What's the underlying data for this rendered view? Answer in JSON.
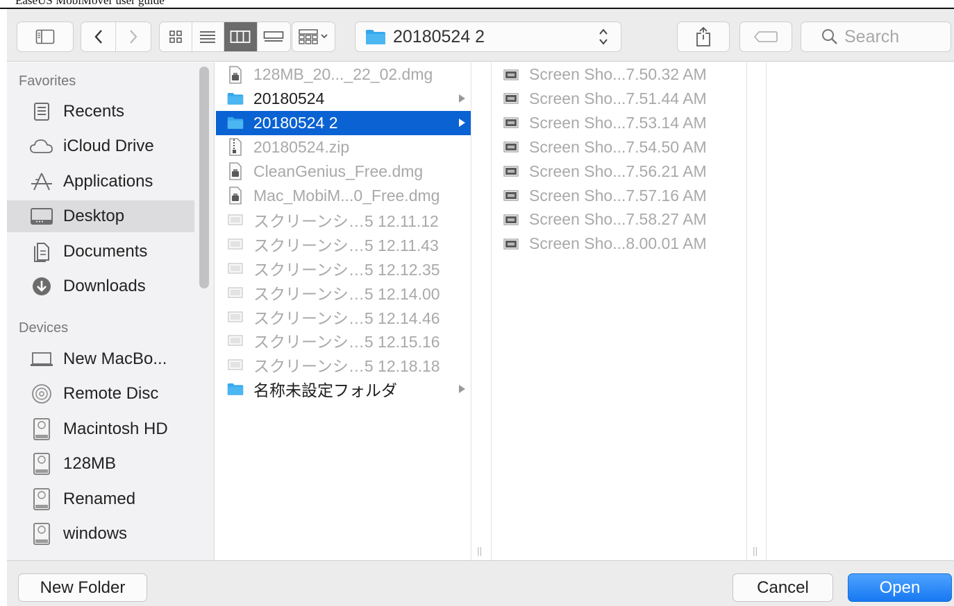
{
  "doc_header": {
    "text": "EaseUS MobiMover user guide"
  },
  "toolbar": {
    "path_label": "20180524 2",
    "search_placeholder": "Search"
  },
  "sidebar": {
    "favorites_heading": "Favorites",
    "favorites": [
      {
        "label": "Recents",
        "icon": "recents-icon"
      },
      {
        "label": "iCloud Drive",
        "icon": "icloud-icon"
      },
      {
        "label": "Applications",
        "icon": "applications-icon"
      },
      {
        "label": "Desktop",
        "icon": "desktop-icon",
        "selected": true
      },
      {
        "label": "Documents",
        "icon": "documents-icon"
      },
      {
        "label": "Downloads",
        "icon": "downloads-icon"
      }
    ],
    "devices_heading": "Devices",
    "devices": [
      {
        "label": "New   MacBo...",
        "icon": "laptop-icon"
      },
      {
        "label": "Remote Disc",
        "icon": "disc-icon"
      },
      {
        "label": "Macintosh HD",
        "icon": "drive-icon"
      },
      {
        "label": "128MB",
        "icon": "drive-icon"
      },
      {
        "label": "Renamed",
        "icon": "drive-icon"
      },
      {
        "label": "windows",
        "icon": "drive-icon"
      }
    ]
  },
  "column1": [
    {
      "label": "128MB_20..._22_02.dmg",
      "type": "dmg",
      "state": "dim"
    },
    {
      "label": "20180524",
      "type": "folder",
      "state": "dark",
      "arrow": true
    },
    {
      "label": "20180524 2",
      "type": "folder",
      "state": "selected",
      "arrow": true
    },
    {
      "label": "20180524.zip",
      "type": "zip",
      "state": "dim"
    },
    {
      "label": "CleanGenius_Free.dmg",
      "type": "dmg",
      "state": "dim"
    },
    {
      "label": "Mac_MobiM...0_Free.dmg",
      "type": "dmg",
      "state": "dim"
    },
    {
      "label": "スクリーンシ…5 12.11.12",
      "type": "image",
      "state": "dim"
    },
    {
      "label": "スクリーンシ…5 12.11.43",
      "type": "image",
      "state": "dim"
    },
    {
      "label": "スクリーンシ…5 12.12.35",
      "type": "image",
      "state": "dim"
    },
    {
      "label": "スクリーンシ…5 12.14.00",
      "type": "image",
      "state": "dim"
    },
    {
      "label": "スクリーンシ…5 12.14.46",
      "type": "image",
      "state": "dim"
    },
    {
      "label": "スクリーンシ…5 12.15.16",
      "type": "image",
      "state": "dim"
    },
    {
      "label": "スクリーンシ…5 12.18.18",
      "type": "image",
      "state": "dim"
    },
    {
      "label": "名称未設定フォルダ",
      "type": "folder",
      "state": "dark",
      "arrow": true
    }
  ],
  "column2": [
    {
      "label": "Screen Sho...7.50.32 AM",
      "type": "screenshot",
      "state": "dim"
    },
    {
      "label": "Screen Sho...7.51.44 AM",
      "type": "screenshot",
      "state": "dim"
    },
    {
      "label": "Screen Sho...7.53.14 AM",
      "type": "screenshot",
      "state": "dim"
    },
    {
      "label": "Screen Sho...7.54.50 AM",
      "type": "screenshot",
      "state": "dim"
    },
    {
      "label": "Screen Sho...7.56.21 AM",
      "type": "screenshot",
      "state": "dim"
    },
    {
      "label": "Screen Sho...7.57.16 AM",
      "type": "screenshot",
      "state": "dim"
    },
    {
      "label": "Screen Sho...7.58.27 AM",
      "type": "screenshot",
      "state": "dim"
    },
    {
      "label": "Screen Sho...8.00.01 AM",
      "type": "screenshot",
      "state": "dim"
    }
  ],
  "footer": {
    "new_folder_label": "New Folder",
    "cancel_label": "Cancel",
    "open_label": "Open"
  },
  "colors": {
    "selection": "#0a62d3",
    "folder": "#35a8ec",
    "primary_button": "#1778f2"
  }
}
